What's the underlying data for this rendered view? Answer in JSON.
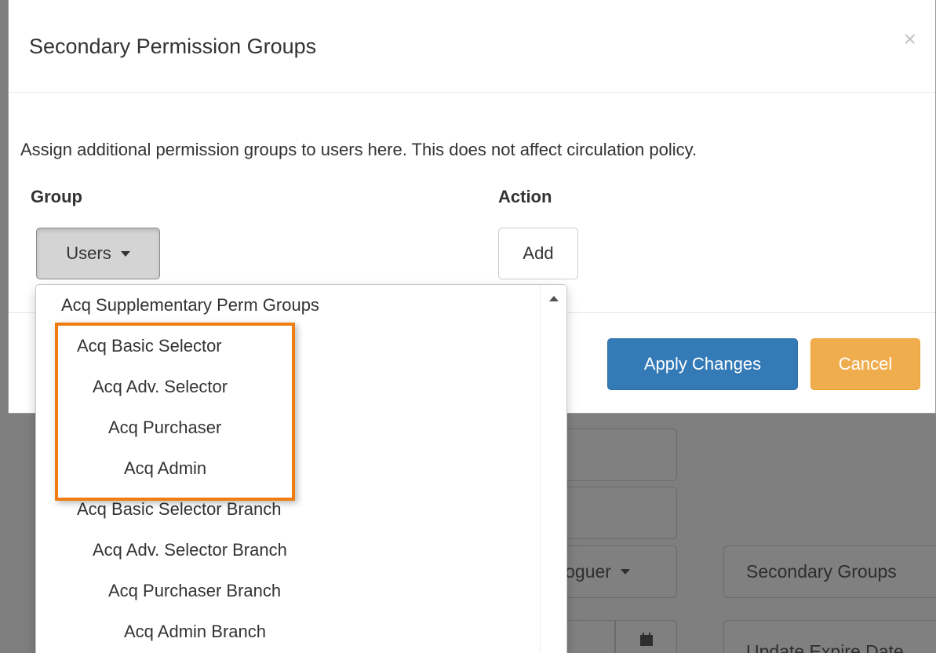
{
  "modal": {
    "title": "Secondary Permission Groups",
    "close_symbol": "×",
    "help_text": "Assign additional permission groups to users here. This does not affect circulation policy.",
    "group_header": "Group",
    "action_header": "Action",
    "group_select_value": "Users",
    "add_label": "Add",
    "apply_label": "Apply Changes",
    "cancel_label": "Cancel"
  },
  "dropdown": {
    "items": [
      "Acq Supplementary Perm Groups",
      "Acq Basic Selector",
      "Acq Adv. Selector",
      "Acq Purchaser",
      "Acq Admin",
      "Acq Basic Selector Branch",
      "Acq Adv. Selector Branch",
      "Acq Purchaser Branch",
      "Acq Admin Branch"
    ]
  },
  "background": {
    "profile_select_partial": "loguer",
    "secondary_groups_label": "Secondary Groups",
    "update_expire_partial": "Update Expire Date"
  },
  "colors": {
    "primary": "#337ab7",
    "warning": "#f0ad4e",
    "highlight": "#f07d11",
    "overlay": "#7f7f7f"
  },
  "icons": {
    "close": "close-icon",
    "caret": "caret-down-icon",
    "scroll_up": "scroll-up-arrow-icon",
    "calendar": "calendar-icon"
  }
}
